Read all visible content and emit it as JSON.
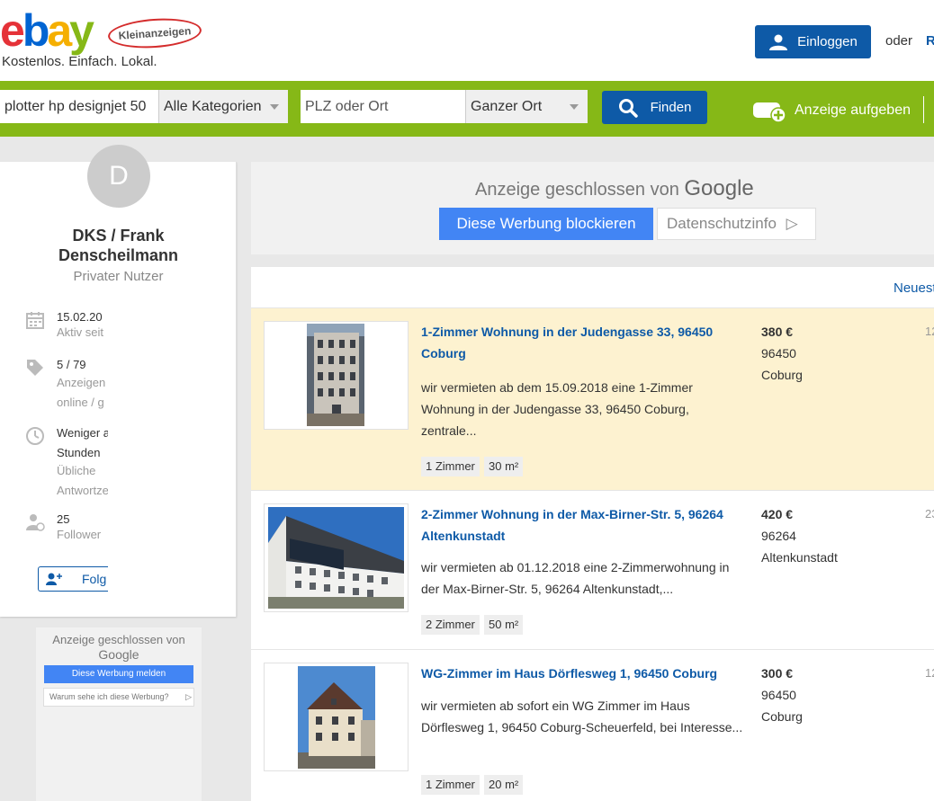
{
  "header": {
    "brand": "ebay",
    "badge": "Kleinanzeigen",
    "tagline": "Kostenlos. Einfach. Lokal.",
    "login_label": "Einloggen",
    "oder": "oder",
    "register_label": "R"
  },
  "search": {
    "query": "plotter hp designjet 50",
    "category": "Alle Kategorien",
    "location_placeholder": "PLZ oder Ort",
    "radius": "Ganzer Ort",
    "find_label": "Finden",
    "post_ad_label": "Anzeige aufgeben"
  },
  "profile": {
    "avatar_letter": "D",
    "name_line1": "DKS / Frank",
    "name_line2": "Denscheilmann",
    "type": "Privater Nutzer",
    "since_value": "15.02.20",
    "since_label": "Aktiv seit",
    "ads_value": "5 / 79",
    "ads_label1": "Anzeigen",
    "ads_label2": "online / g",
    "response_line1": "Weniger a",
    "response_line2": "Stunden",
    "response_label1": "Übliche",
    "response_label2": "Antwortze",
    "followers_value": "25",
    "followers_label": "Follower",
    "follow_label": "Folg"
  },
  "left_ad": {
    "closed_text": "Anzeige geschlossen von",
    "google": "Google",
    "report_label": "Diese Werbung melden",
    "why_label": "Warum sehe ich diese Werbung?"
  },
  "top_ad": {
    "closed_text": "Anzeige geschlossen von",
    "google": "Google",
    "block_label": "Diese Werbung blockieren",
    "privacy_label": "Datenschutzinfo"
  },
  "sort": {
    "label": "Neuest"
  },
  "listings": [
    {
      "title": "1-Zimmer Wohnung in der Judengasse 33, 96450 Coburg",
      "description": "wir vermieten ab dem 15.09.2018 eine 1-Zimmer Wohnung in der Judengasse 33, 96450 Coburg, zentrale...",
      "tags": [
        "1 Zimmer",
        "30 m²"
      ],
      "price": "380 €",
      "zip": "96450",
      "city": "Coburg",
      "date": "12"
    },
    {
      "title": "2-Zimmer Wohnung in der Max-Birner-Str. 5, 96264 Altenkunstadt",
      "description": "wir vermieten ab 01.12.2018 eine 2-Zimmerwohnung in der Max-Birner-Str. 5, 96264 Altenkunstadt,...",
      "tags": [
        "2 Zimmer",
        "50 m²"
      ],
      "price": "420 €",
      "zip": "96264",
      "city": "Altenkunstadt",
      "date": "23"
    },
    {
      "title": "WG-Zimmer im Haus Dörflesweg 1, 96450 Coburg",
      "description": "wir vermieten ab sofort ein WG Zimmer im Haus Dörflesweg 1, 96450 Coburg-Scheuerfeld, bei Interesse...",
      "tags": [
        "1 Zimmer",
        "20 m²"
      ],
      "price": "300 €",
      "zip": "96450",
      "city": "Coburg",
      "date": "12"
    }
  ],
  "colors": {
    "green_bar": "#86b817",
    "primary_blue": "#0e5aa7",
    "google_blue": "#4285f4",
    "highlight": "#fdf2d0"
  }
}
